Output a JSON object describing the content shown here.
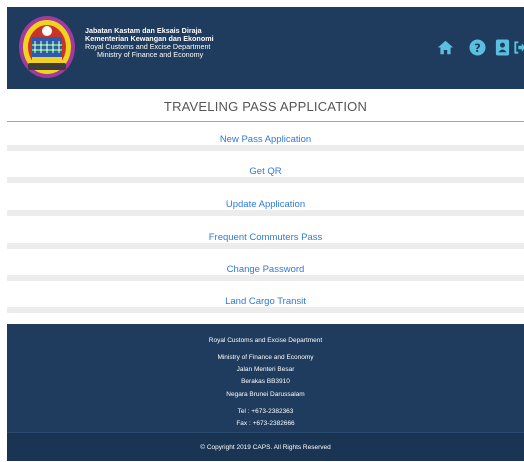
{
  "header": {
    "agency_line1": "Jabatan Kastam dan Eksais Diraja",
    "agency_line2": "Kementerian Kewangan dan Ekonomi",
    "agency_line3": "Royal Customs and Excise Department",
    "agency_line4": "Ministry of Finance and Economy",
    "colors": {
      "background": "#1f3b5d",
      "icon": "#5bc0de"
    },
    "nav_icons": [
      "home-icon",
      "help-icon",
      "contact-book-icon",
      "logout-icon"
    ]
  },
  "page_title": "TRAVELING PASS APPLICATION",
  "menu": {
    "items": [
      {
        "label": "New Pass Application"
      },
      {
        "label": "Get QR"
      },
      {
        "label": "Update Application"
      },
      {
        "label": "Frequent Commuters Pass"
      },
      {
        "label": "Change Password"
      },
      {
        "label": "Land Cargo Transit"
      }
    ],
    "link_color": "#2f7ad6"
  },
  "footer": {
    "department": "Royal Customs and Excise Department",
    "ministry": "Ministry of Finance and Economy",
    "address1": "Jalan Menteri Besar",
    "address2": "Berakas BB3910",
    "address3": "Negara Brunei Darussalam",
    "tel": "Tel : +673-2382363",
    "fax": "Fax : +673-2382666",
    "copyright": "© Copyright 2019 CAPS. All Rights Reserved"
  }
}
